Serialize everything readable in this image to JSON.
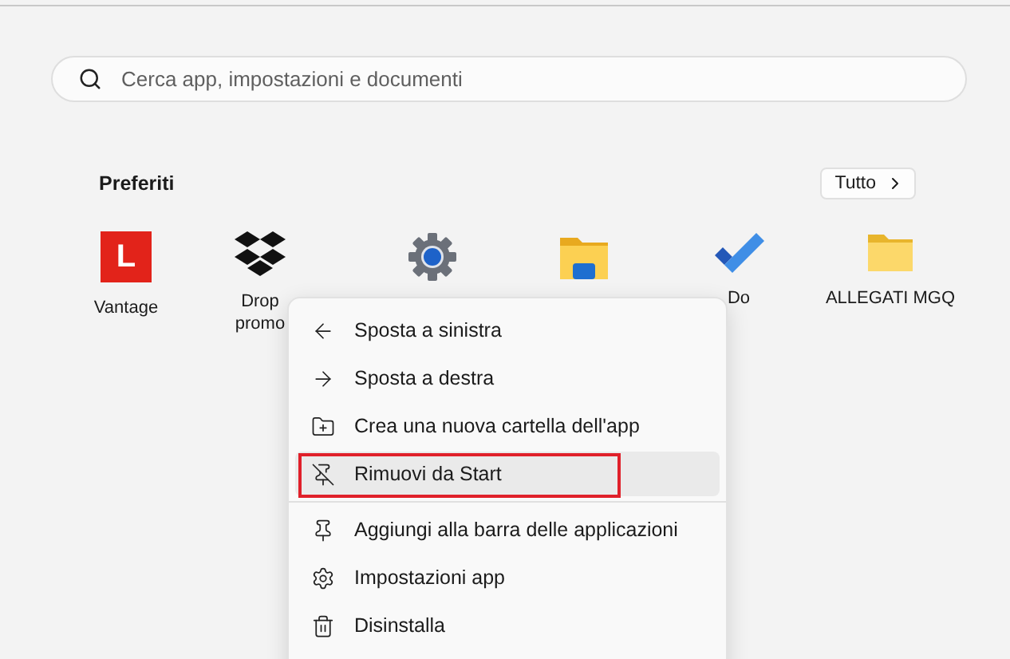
{
  "search": {
    "placeholder": "Cerca app, impostazioni e documenti"
  },
  "pinned": {
    "title": "Preferiti",
    "all_button": "Tutto",
    "apps": [
      {
        "kind": "letter-logo",
        "logo_letter": "L",
        "label": [
          "Vantage"
        ]
      },
      {
        "kind": "diamonds",
        "label": [
          "Drop",
          "promo"
        ]
      },
      {
        "kind": "gear"
      },
      {
        "kind": "folder-panel"
      },
      {
        "kind": "check",
        "label": [
          "Do"
        ]
      },
      {
        "kind": "folder",
        "label": [
          "ALLEGATI MGQ"
        ]
      }
    ]
  },
  "context_menu": {
    "groups": [
      [
        {
          "kind": "arrow-left",
          "label": "Sposta a sinistra",
          "selected": false,
          "outlined": false
        },
        {
          "kind": "arrow-right",
          "label": "Sposta a destra",
          "selected": false,
          "outlined": false
        },
        {
          "kind": "folder-plus",
          "label": "Crea una nuova cartella dell'app",
          "selected": false,
          "outlined": false
        },
        {
          "kind": "unpin",
          "label": "Rimuovi da Start",
          "selected": true,
          "outlined": true
        }
      ],
      [
        {
          "kind": "pin",
          "label": "Aggiungi alla barra delle applicazioni",
          "selected": false,
          "outlined": false
        },
        {
          "kind": "gear",
          "label": "Impostazioni app",
          "selected": false,
          "outlined": false
        },
        {
          "kind": "trash",
          "label": "Disinstalla",
          "selected": false,
          "outlined": false
        }
      ]
    ]
  }
}
